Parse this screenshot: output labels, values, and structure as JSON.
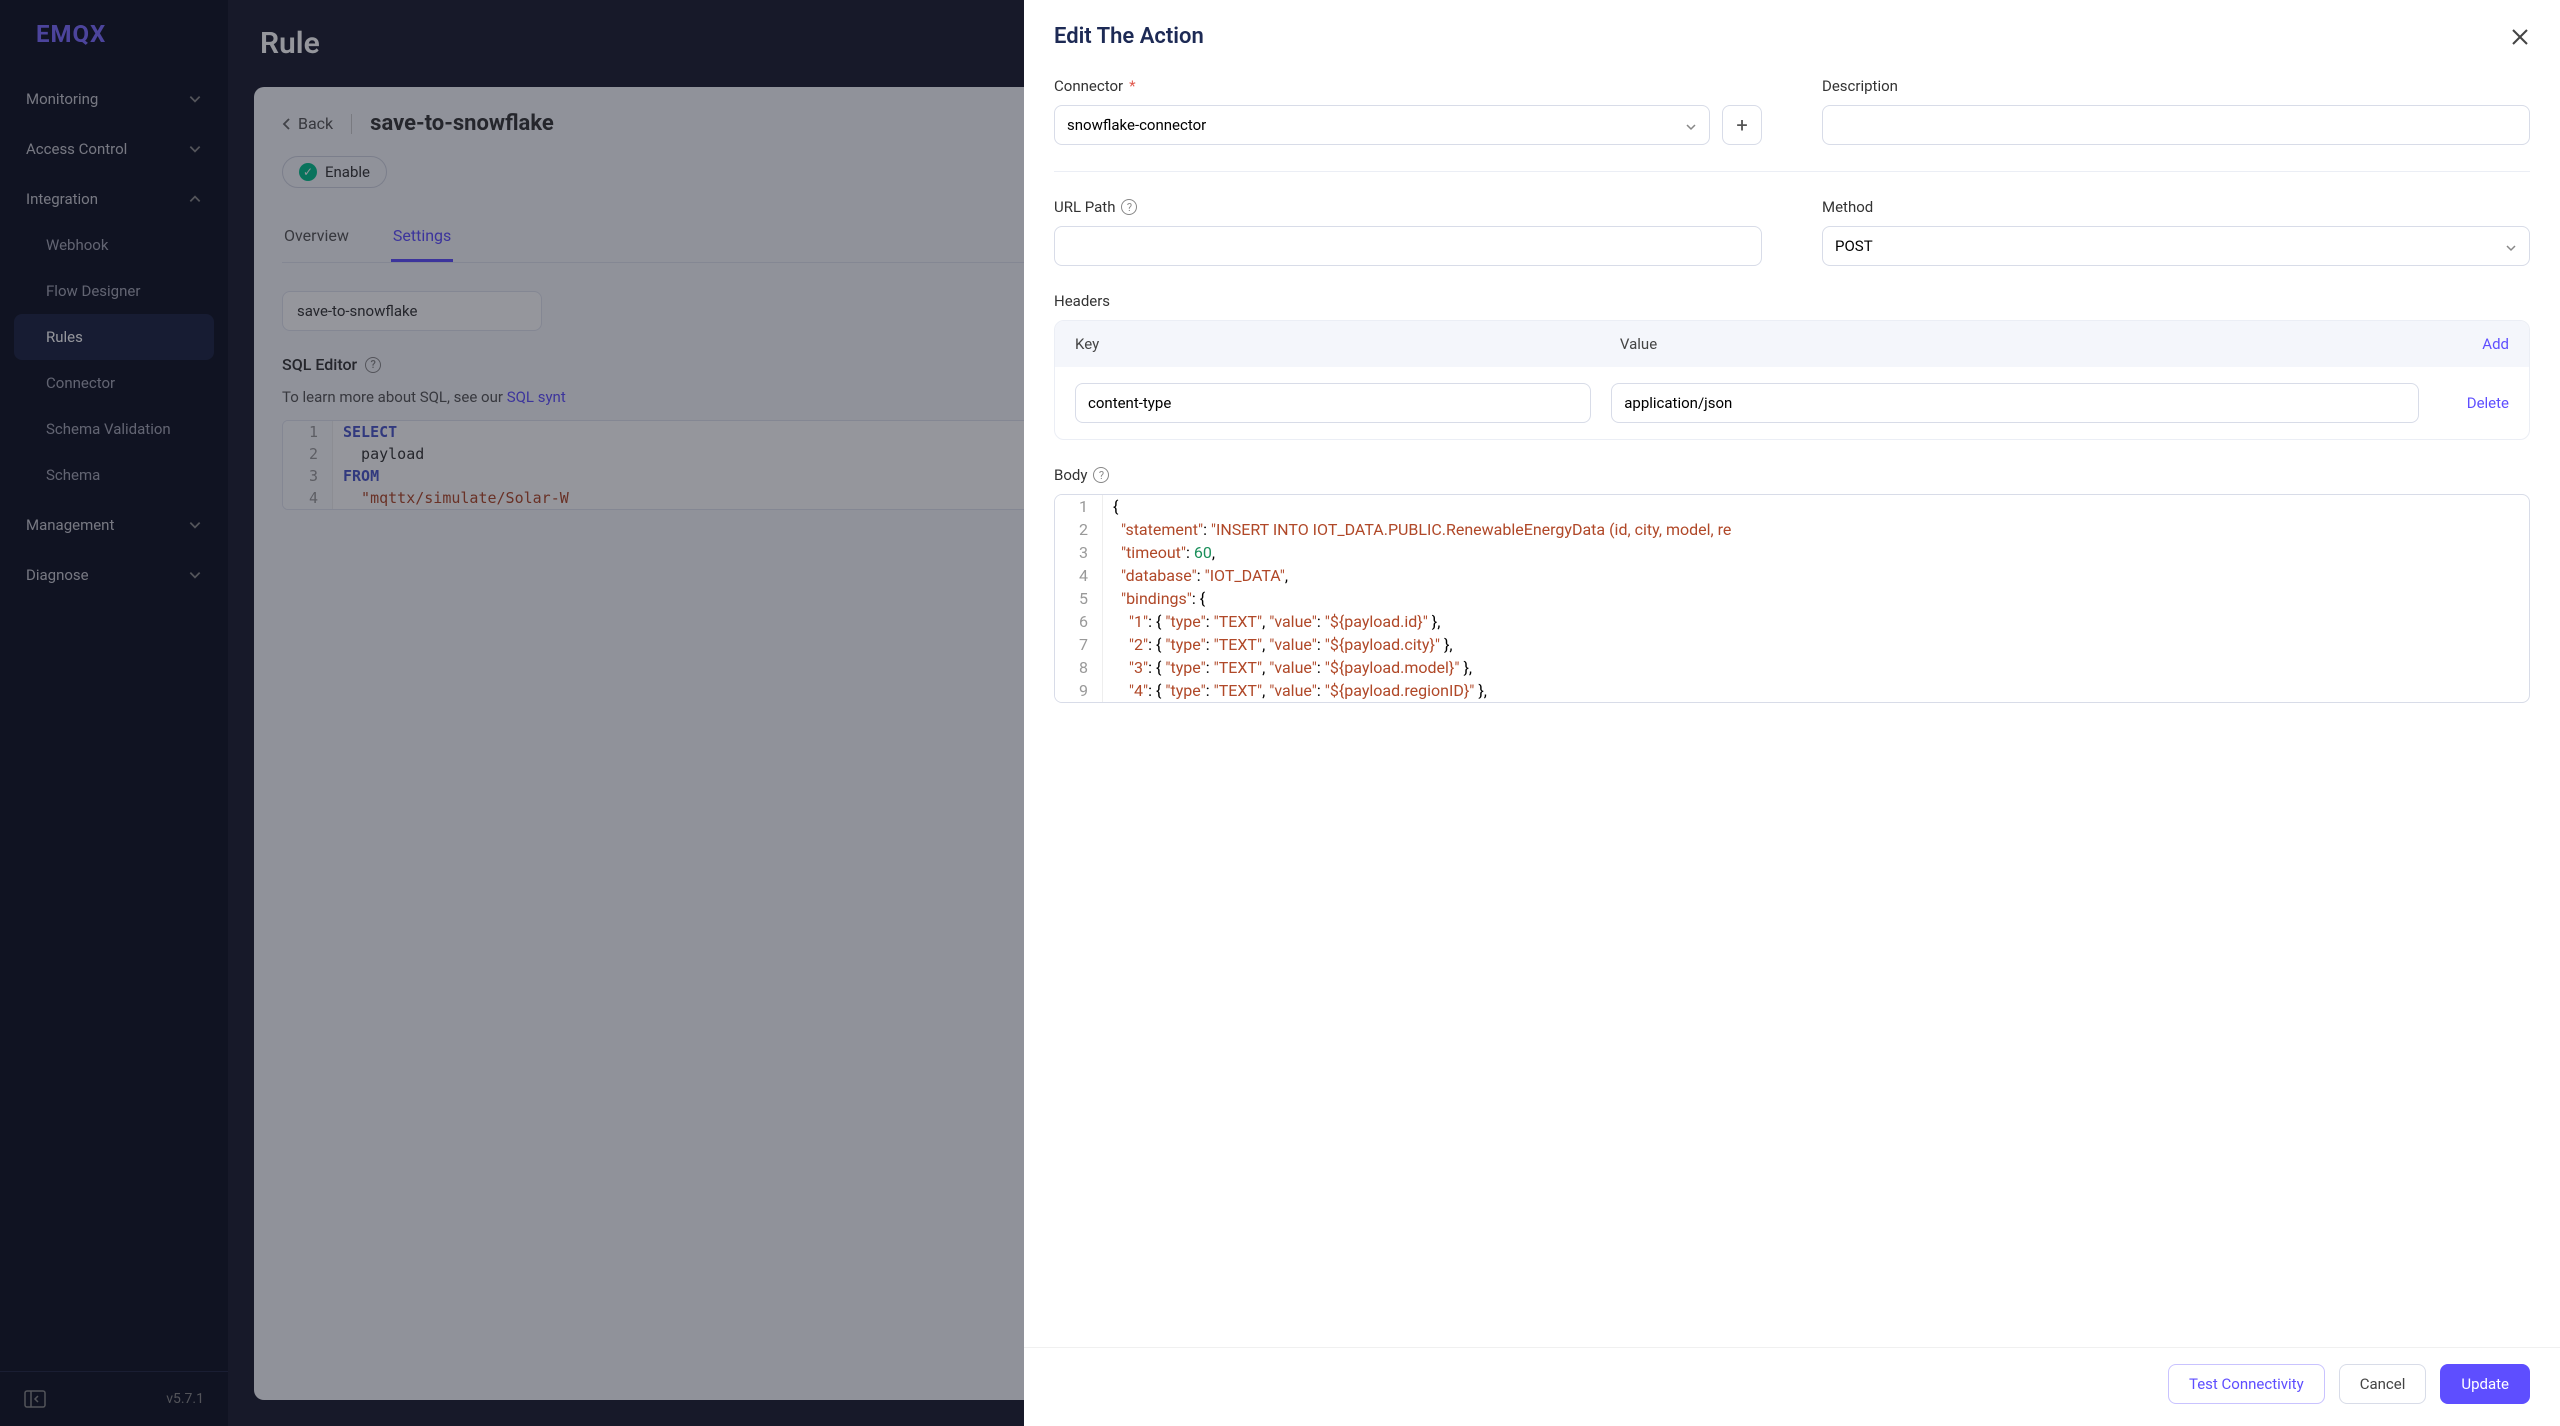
{
  "brand": "EMQX",
  "version": "v5.7.1",
  "page_title": "Rule",
  "sidebar": {
    "groups": [
      {
        "label": "Monitoring",
        "expanded": false,
        "items": []
      },
      {
        "label": "Access Control",
        "expanded": false,
        "items": []
      },
      {
        "label": "Integration",
        "expanded": true,
        "items": [
          {
            "label": "Webhook",
            "active": false
          },
          {
            "label": "Flow Designer",
            "active": false
          },
          {
            "label": "Rules",
            "active": true
          },
          {
            "label": "Connector",
            "active": false
          },
          {
            "label": "Schema Validation",
            "active": false
          },
          {
            "label": "Schema",
            "active": false
          }
        ]
      },
      {
        "label": "Management",
        "expanded": false,
        "items": []
      },
      {
        "label": "Diagnose",
        "expanded": false,
        "items": []
      }
    ]
  },
  "breadcrumb": {
    "back": "Back",
    "rule_name": "save-to-snowflake"
  },
  "enable_label": "Enable",
  "tabs": {
    "overview": "Overview",
    "settings": "Settings",
    "active": "settings"
  },
  "rule_id": "save-to-snowflake",
  "sql_editor": {
    "label": "SQL Editor",
    "hint_prefix": "To learn more about SQL, see our ",
    "hint_link": "SQL synt",
    "lines": [
      {
        "n": "1",
        "segs": [
          {
            "t": "SELECT",
            "cls": "kw"
          }
        ]
      },
      {
        "n": "2",
        "segs": [
          {
            "t": "  payload",
            "cls": ""
          }
        ]
      },
      {
        "n": "3",
        "segs": [
          {
            "t": "FROM",
            "cls": "kw"
          }
        ]
      },
      {
        "n": "4",
        "segs": [
          {
            "t": "  \"mqttx/simulate/Solar-W",
            "cls": "str"
          }
        ]
      }
    ]
  },
  "drawer": {
    "title": "Edit The Action",
    "connector_label": "Connector",
    "connector_value": "snowflake-connector",
    "description_label": "Description",
    "description_value": "",
    "url_label": "URL Path",
    "url_value": "",
    "method_label": "Method",
    "method_value": "POST",
    "headers_label": "Headers",
    "headers": {
      "cols": {
        "key": "Key",
        "value": "Value",
        "add": "Add",
        "delete": "Delete"
      },
      "rows": [
        {
          "key": "content-type",
          "value": "application/json"
        }
      ]
    },
    "body_label": "Body",
    "body_lines": [
      {
        "n": "1",
        "raw": "{",
        "segs": [
          {
            "t": "{",
            "cls": ""
          }
        ]
      },
      {
        "n": "2",
        "raw": "  \"statement\": \"INSERT INTO IOT_DATA.PUBLIC.RenewableEnergyData (id, city, model, re",
        "segs": [
          {
            "t": "  ",
            "cls": ""
          },
          {
            "t": "\"statement\"",
            "cls": "str"
          },
          {
            "t": ": ",
            "cls": ""
          },
          {
            "t": "\"INSERT INTO IOT_DATA.PUBLIC.RenewableEnergyData (id, city, model, re",
            "cls": "str"
          }
        ]
      },
      {
        "n": "3",
        "raw": "  \"timeout\": 60,",
        "segs": [
          {
            "t": "  ",
            "cls": ""
          },
          {
            "t": "\"timeout\"",
            "cls": "str"
          },
          {
            "t": ": ",
            "cls": ""
          },
          {
            "t": "60",
            "cls": "num"
          },
          {
            "t": ",",
            "cls": ""
          }
        ]
      },
      {
        "n": "4",
        "raw": "  \"database\": \"IOT_DATA\",",
        "segs": [
          {
            "t": "  ",
            "cls": ""
          },
          {
            "t": "\"database\"",
            "cls": "str"
          },
          {
            "t": ": ",
            "cls": ""
          },
          {
            "t": "\"IOT_DATA\"",
            "cls": "str"
          },
          {
            "t": ",",
            "cls": ""
          }
        ]
      },
      {
        "n": "5",
        "raw": "  \"bindings\": {",
        "segs": [
          {
            "t": "  ",
            "cls": ""
          },
          {
            "t": "\"bindings\"",
            "cls": "str"
          },
          {
            "t": ": {",
            "cls": ""
          }
        ]
      },
      {
        "n": "6",
        "raw": "    \"1\": { \"type\": \"TEXT\", \"value\": \"${payload.id}\" },",
        "segs": [
          {
            "t": "    ",
            "cls": ""
          },
          {
            "t": "\"1\"",
            "cls": "str"
          },
          {
            "t": ": { ",
            "cls": ""
          },
          {
            "t": "\"type\"",
            "cls": "str"
          },
          {
            "t": ": ",
            "cls": ""
          },
          {
            "t": "\"TEXT\"",
            "cls": "str"
          },
          {
            "t": ", ",
            "cls": ""
          },
          {
            "t": "\"value\"",
            "cls": "str"
          },
          {
            "t": ": ",
            "cls": ""
          },
          {
            "t": "\"${payload.id}\"",
            "cls": "str"
          },
          {
            "t": " },",
            "cls": ""
          }
        ]
      },
      {
        "n": "7",
        "raw": "    \"2\": { \"type\": \"TEXT\", \"value\": \"${payload.city}\" },",
        "segs": [
          {
            "t": "    ",
            "cls": ""
          },
          {
            "t": "\"2\"",
            "cls": "str"
          },
          {
            "t": ": { ",
            "cls": ""
          },
          {
            "t": "\"type\"",
            "cls": "str"
          },
          {
            "t": ": ",
            "cls": ""
          },
          {
            "t": "\"TEXT\"",
            "cls": "str"
          },
          {
            "t": ", ",
            "cls": ""
          },
          {
            "t": "\"value\"",
            "cls": "str"
          },
          {
            "t": ": ",
            "cls": ""
          },
          {
            "t": "\"${payload.city}\"",
            "cls": "str"
          },
          {
            "t": " },",
            "cls": ""
          }
        ]
      },
      {
        "n": "8",
        "raw": "    \"3\": { \"type\": \"TEXT\", \"value\": \"${payload.model}\" },",
        "segs": [
          {
            "t": "    ",
            "cls": ""
          },
          {
            "t": "\"3\"",
            "cls": "str"
          },
          {
            "t": ": { ",
            "cls": ""
          },
          {
            "t": "\"type\"",
            "cls": "str"
          },
          {
            "t": ": ",
            "cls": ""
          },
          {
            "t": "\"TEXT\"",
            "cls": "str"
          },
          {
            "t": ", ",
            "cls": ""
          },
          {
            "t": "\"value\"",
            "cls": "str"
          },
          {
            "t": ": ",
            "cls": ""
          },
          {
            "t": "\"${payload.model}\"",
            "cls": "str"
          },
          {
            "t": " },",
            "cls": ""
          }
        ]
      },
      {
        "n": "9",
        "raw": "    \"4\": { \"type\": \"TEXT\", \"value\": \"${payload.regionID}\" },",
        "segs": [
          {
            "t": "    ",
            "cls": ""
          },
          {
            "t": "\"4\"",
            "cls": "str"
          },
          {
            "t": ": { ",
            "cls": ""
          },
          {
            "t": "\"type\"",
            "cls": "str"
          },
          {
            "t": ": ",
            "cls": ""
          },
          {
            "t": "\"TEXT\"",
            "cls": "str"
          },
          {
            "t": ", ",
            "cls": ""
          },
          {
            "t": "\"value\"",
            "cls": "str"
          },
          {
            "t": ": ",
            "cls": ""
          },
          {
            "t": "\"${payload.regionID}\"",
            "cls": "str"
          },
          {
            "t": " },",
            "cls": ""
          }
        ]
      }
    ],
    "footer": {
      "test": "Test Connectivity",
      "cancel": "Cancel",
      "update": "Update"
    }
  }
}
